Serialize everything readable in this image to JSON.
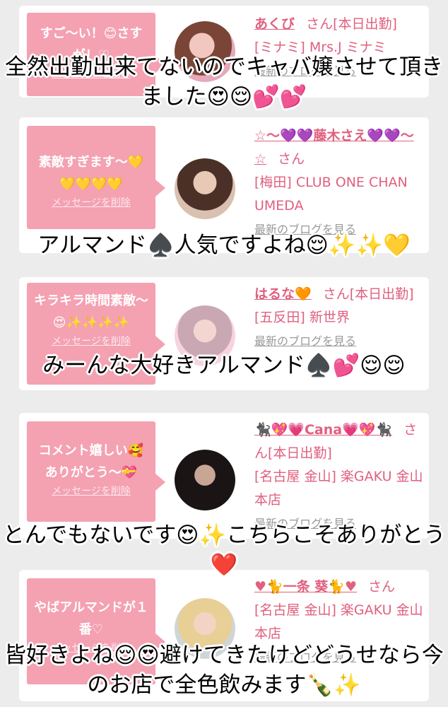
{
  "cards": [
    {
      "message": "すご〜い！😊さすが！♡",
      "delete_label": "メッセージを削除",
      "name": "あくび",
      "suffix": "さん[本日出勤]",
      "shop": "[ミナミ] Mrs.J ミナミ",
      "blog": "最新のブログを見る"
    },
    {
      "message": "素敵すぎます〜💛💛💛💛💛",
      "delete_label": "メッセージを削除",
      "name": "☆〜💜💜藤木さえ💜💜〜☆",
      "suffix": "さん",
      "shop": "[梅田] CLUB ONE CHAN UMEDA",
      "blog": "最新のブログを見る"
    },
    {
      "message": "キラキラ時間素敵〜😍✨✨✨✨",
      "delete_label": "メッセージを削除",
      "name": "はるな🧡",
      "suffix": "さん[本日出勤]",
      "shop": "[五反田] 新世界",
      "blog": "最新のブログを見る"
    },
    {
      "message": "コメント嬉しい🥰ありがとう〜💝",
      "delete_label": "メッセージを削除",
      "name": "🐈‍⬛💖💗Cana💗💖🐈‍⬛",
      "suffix": "さん[本日出勤]",
      "shop": "[名古屋 金山] 楽GAKU 金山本店",
      "blog": "最新のブログを見る"
    },
    {
      "message": "やばアルマンドが１番♡",
      "delete_label": "メッセージを削除",
      "name": "♥🐈一条 葵🐈♥",
      "suffix": "さん",
      "shop": "[名古屋 金山] 楽GAKU 金山本店",
      "blog": "最新のブログを見る"
    }
  ],
  "captions": [
    "全然出勤出来てないのでキャバ嬢させて頂きました😍😌💕💕",
    "アルマンド♠️人気ですよね😌✨✨💛",
    "みーんな大好きアルマンド♠️💕😌😌",
    "とんでもないです😍✨こちらこそありがとう❤️",
    "皆好きよね😌😍避けてきたけどどうせなら今のお店で全色飲みます🍾✨"
  ]
}
